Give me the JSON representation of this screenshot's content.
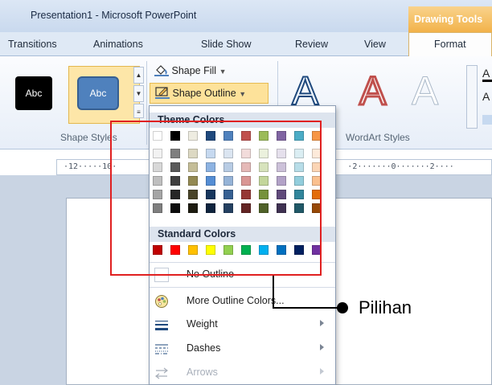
{
  "window": {
    "title": "Presentation1 - Microsoft PowerPoint",
    "contextual_tab_group": "Drawing Tools"
  },
  "tabs": [
    "Transitions",
    "Animations",
    "Slide Show",
    "Review",
    "View",
    "Format"
  ],
  "active_tab": "Format",
  "ribbon": {
    "shape_styles": {
      "label": "Shape Styles",
      "thumbnails": [
        {
          "text": "Abc",
          "fill": "#000000"
        },
        {
          "text": "Abc",
          "fill": "#4f81bd"
        }
      ]
    },
    "shape_fill_label": "Shape Fill",
    "shape_outline_label": "Shape Outline",
    "wordart_styles": {
      "label": "WordArt Styles",
      "letters": [
        "A",
        "A",
        "A"
      ]
    }
  },
  "ruler": {
    "left_text": "·12·····10·",
    "right_text": "·2·······0·······2····"
  },
  "dropdown": {
    "theme_colors_heading": "Theme Colors",
    "theme_top_row": [
      "#ffffff",
      "#000000",
      "#eeece1",
      "#1f497d",
      "#4f81bd",
      "#c0504d",
      "#9bbb59",
      "#8064a2",
      "#4bacc6",
      "#f79646"
    ],
    "theme_shades": [
      [
        "#f2f2f2",
        "#7f7f7f",
        "#ddd9c3",
        "#c6d9f0",
        "#dbe5f1",
        "#f2dcdb",
        "#ebf1dd",
        "#e5e0ec",
        "#dbeef3",
        "#fdeada"
      ],
      [
        "#d8d8d8",
        "#595959",
        "#c4bd97",
        "#8db3e2",
        "#b8cce4",
        "#e5b9b7",
        "#d7e3bc",
        "#ccc1d9",
        "#b7dde8",
        "#fbd5b5"
      ],
      [
        "#bfbfbf",
        "#3f3f3f",
        "#938953",
        "#548dd4",
        "#95b3d7",
        "#d99694",
        "#c3d69b",
        "#b2a2c7",
        "#92cddc",
        "#fac08f"
      ],
      [
        "#a5a5a5",
        "#262626",
        "#494429",
        "#17365d",
        "#366092",
        "#953734",
        "#76923c",
        "#5f497a",
        "#31859b",
        "#e36c09"
      ],
      [
        "#7f7f7f",
        "#0c0c0c",
        "#1d1b10",
        "#0f243e",
        "#244061",
        "#632423",
        "#4f6128",
        "#3f3151",
        "#205867",
        "#974806"
      ]
    ],
    "standard_colors_heading": "Standard Colors",
    "standard_colors": [
      "#c00000",
      "#ff0000",
      "#ffc000",
      "#ffff00",
      "#92d050",
      "#00b050",
      "#00b0f0",
      "#0070c0",
      "#002060",
      "#7030a0"
    ],
    "items": [
      {
        "label": "No Outline",
        "icon": "no-outline-icon",
        "submenu": false,
        "enabled": true
      },
      {
        "label": "More Outline Colors...",
        "icon": "color-palette-icon",
        "submenu": false,
        "enabled": true
      },
      {
        "label": "Weight",
        "icon": "line-weight-icon",
        "submenu": true,
        "enabled": true
      },
      {
        "label": "Dashes",
        "icon": "dashes-icon",
        "submenu": true,
        "enabled": true
      },
      {
        "label": "Arrows",
        "icon": "arrows-icon",
        "submenu": true,
        "enabled": false
      }
    ]
  },
  "annotation": {
    "label": "Pilihan",
    "box_color": "#e02020"
  }
}
